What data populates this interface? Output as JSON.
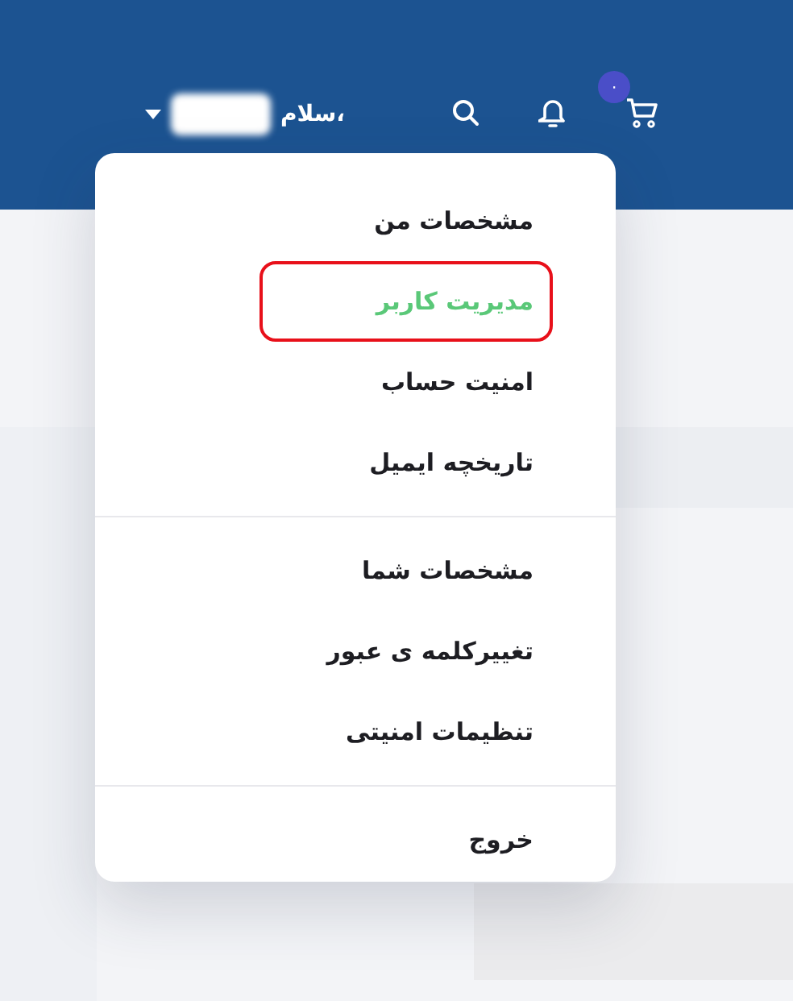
{
  "header": {
    "cart_badge": "۰",
    "greeting": "سلام،"
  },
  "menu": {
    "groups": [
      {
        "items": [
          {
            "label": "مشخصات من",
            "selected": false,
            "highlighted": false
          },
          {
            "label": "مدیریت کاربر",
            "selected": true,
            "highlighted": true
          },
          {
            "label": "امنیت حساب",
            "selected": false,
            "highlighted": false
          },
          {
            "label": "تاریخچه ایمیل",
            "selected": false,
            "highlighted": false
          }
        ]
      },
      {
        "items": [
          {
            "label": "مشخصات شما",
            "selected": false,
            "highlighted": false
          },
          {
            "label": "تغییرکلمه ی عبور",
            "selected": false,
            "highlighted": false
          },
          {
            "label": "تنظیمات امنیتی",
            "selected": false,
            "highlighted": false
          }
        ]
      },
      {
        "items": [
          {
            "label": "خروج",
            "selected": false,
            "highlighted": false
          }
        ]
      }
    ]
  }
}
